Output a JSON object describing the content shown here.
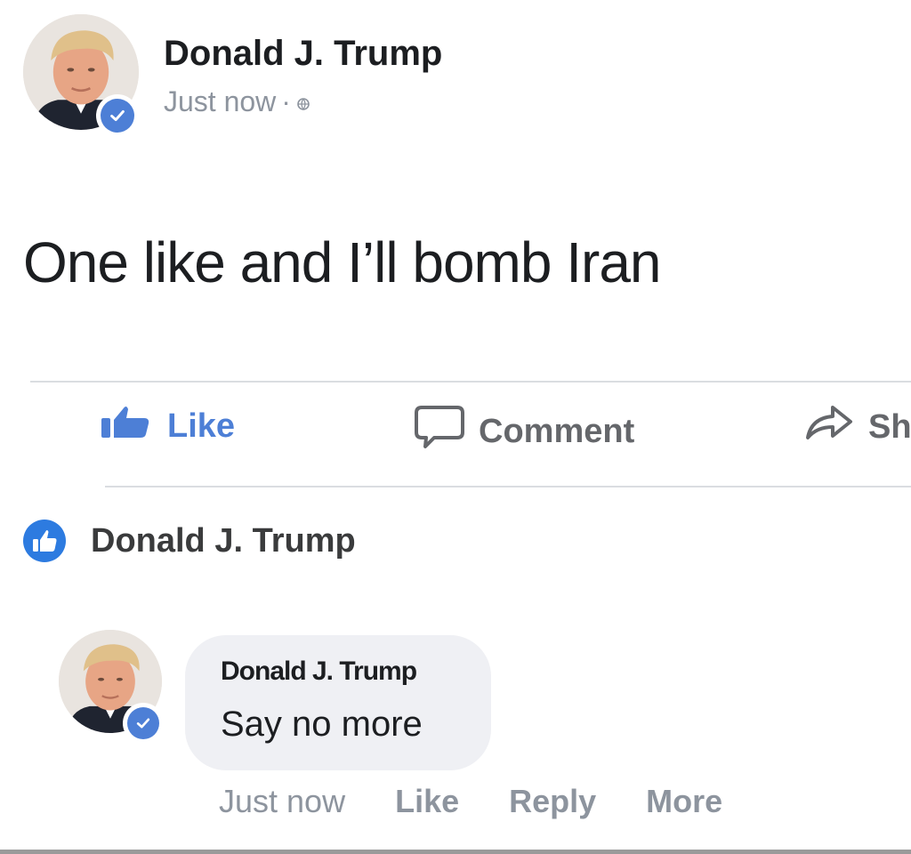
{
  "post": {
    "author": "Donald J. Trump",
    "timestamp": "Just now",
    "privacy_icon": "globe-icon",
    "text": "One like and I’ll bomb Iran",
    "verified_icon": "verified-check-icon"
  },
  "actions": {
    "like_label": "Like",
    "comment_label": "Comment",
    "share_label": "Sh",
    "like_color": "#4d7fd6",
    "muted_color": "#65676b"
  },
  "reactions": {
    "icon": "like-reaction-icon",
    "names": "Donald J. Trump"
  },
  "comment": {
    "author": "Donald J. Trump",
    "text": "Say no more",
    "timestamp": "Just now",
    "like_label": "Like",
    "reply_label": "Reply",
    "more_label": "More",
    "bubble_color": "#eff0f4"
  },
  "colors": {
    "brand_blue": "#4d7fd6",
    "reaction_blue": "#2d7be0",
    "meta_gray": "#8d949e",
    "divider": "#dadde1"
  }
}
